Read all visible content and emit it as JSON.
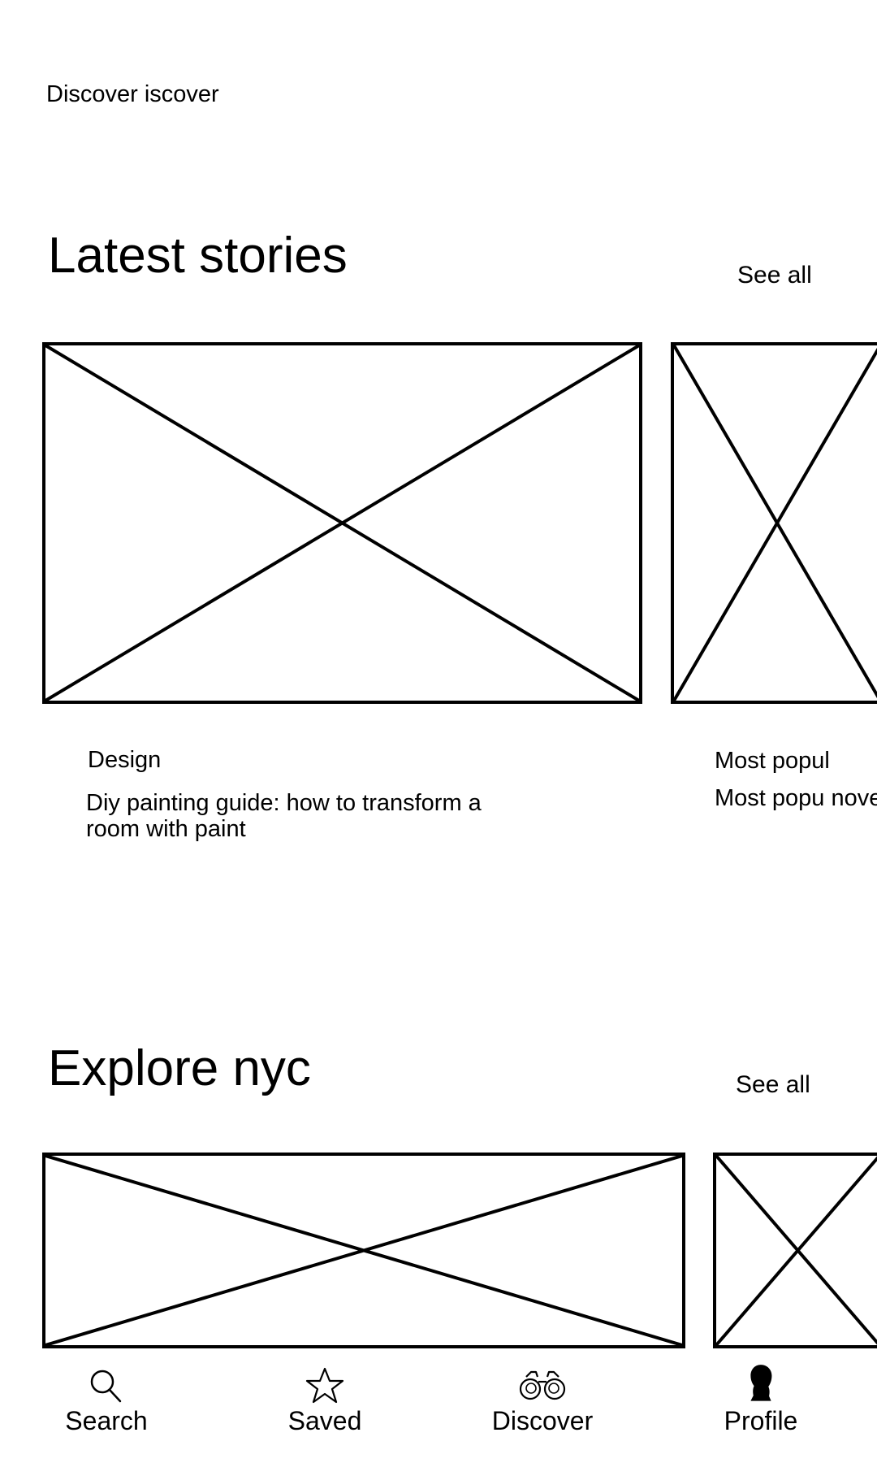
{
  "header": {
    "title": "Discover iscover"
  },
  "latest_stories": {
    "title": "Latest stories",
    "see_all_label": "See all",
    "cards": [
      {
        "tag": "Design",
        "title": "Diy painting guide: how to transform a room with paint"
      },
      {
        "tag": "Most popul",
        "title": "Most popu nove"
      }
    ]
  },
  "explore_nyc": {
    "title": "Explore nyc",
    "see_all_label": "See all"
  },
  "bottom_nav": {
    "items": [
      {
        "label": "Search",
        "icon": "search-icon"
      },
      {
        "label": "Saved",
        "icon": "star-icon"
      },
      {
        "label": "Discover",
        "icon": "binoculars-icon"
      },
      {
        "label": "Profile",
        "icon": "person-silhouette-icon"
      }
    ]
  }
}
